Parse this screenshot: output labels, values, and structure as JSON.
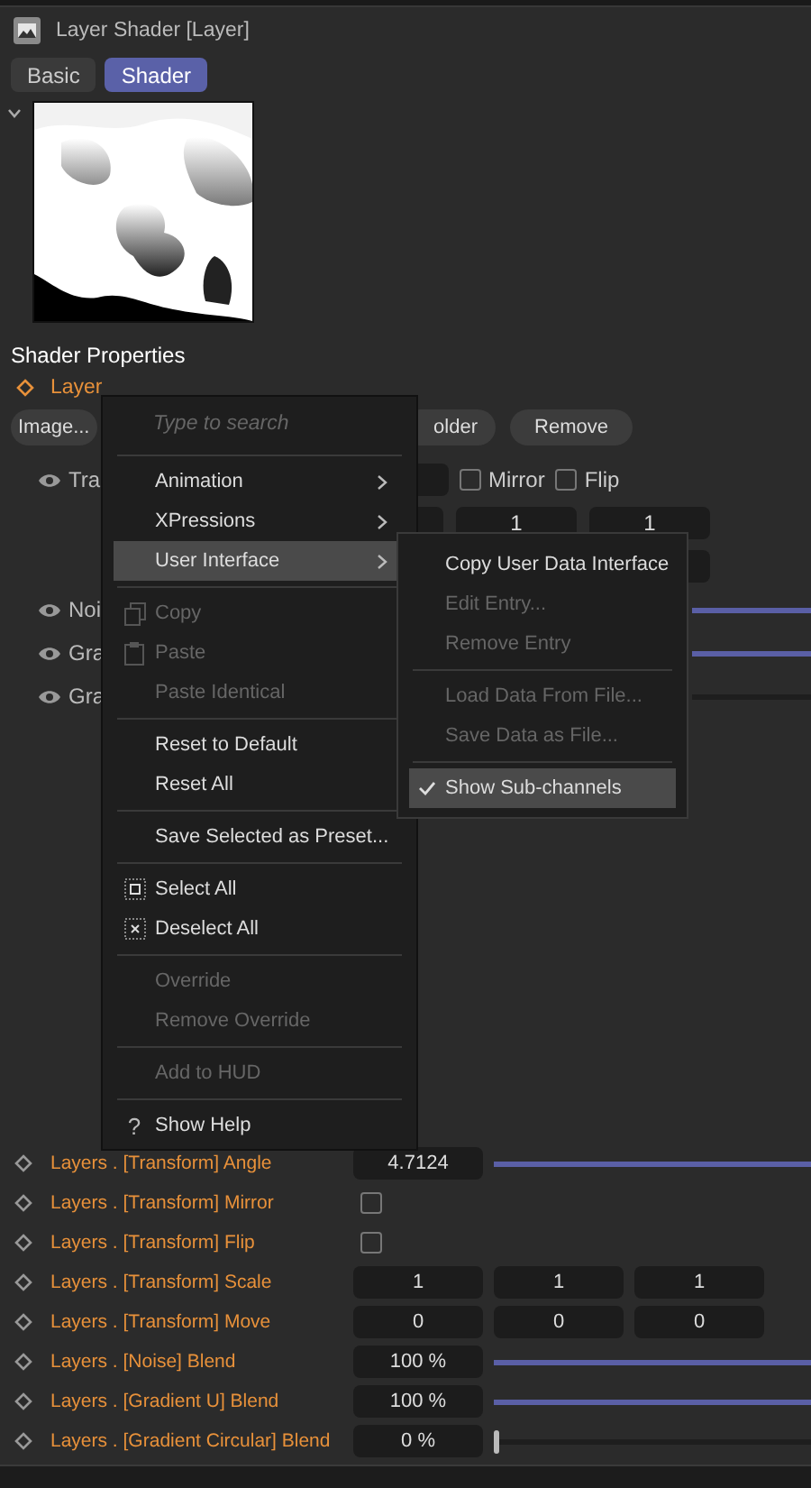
{
  "window": {
    "title": "Layer Shader [Layer]"
  },
  "tabs": [
    {
      "label": "Basic",
      "selected": false
    },
    {
      "label": "Shader",
      "selected": true
    }
  ],
  "preview": {
    "expanded": true
  },
  "section_title": "Shader Properties",
  "layers_label": "Layer",
  "buttons": [
    "Image...",
    "older",
    "Remove"
  ],
  "layer_rows": [
    {
      "kind": "transform",
      "label": "Tra",
      "visible": true
    },
    {
      "kind": "slider",
      "label": "Noi",
      "visible": true,
      "level": 1
    },
    {
      "kind": "slider",
      "label": "Gra",
      "visible": true,
      "level": 1
    },
    {
      "kind": "slider",
      "label": "Gra",
      "visible": true
    }
  ],
  "transform_options": [
    {
      "label": "Mirror",
      "checked": false
    },
    {
      "label": "Flip",
      "checked": false
    }
  ],
  "scale_fields": [
    "1",
    "1"
  ],
  "user_data_rows": [
    {
      "kind": "slider",
      "label": "Layers . [Transform] Angle",
      "value": "4.7124",
      "level": 1
    },
    {
      "kind": "checkbox",
      "label": "Layers . [Transform] Mirror",
      "checked": false
    },
    {
      "kind": "checkbox",
      "label": "Layers . [Transform] Flip",
      "checked": false
    },
    {
      "kind": "vector",
      "label": "Layers . [Transform] Scale",
      "values": [
        "1",
        "1",
        "1"
      ]
    },
    {
      "kind": "vector",
      "label": "Layers . [Transform] Move",
      "values": [
        "0",
        "0",
        "0"
      ]
    },
    {
      "kind": "slider",
      "label": "Layers . [Noise] Blend",
      "value": "100 %",
      "level": 1
    },
    {
      "kind": "slider",
      "label": "Layers . [Gradient U] Blend",
      "value": "100 %",
      "level": 1
    },
    {
      "kind": "slider",
      "label": "Layers . [Gradient Circular] Blend",
      "value": "0 %",
      "level": 0
    }
  ],
  "context_menu": {
    "search": {
      "placeholder": "Type to search"
    },
    "items": [
      {
        "kind": "separator"
      },
      {
        "kind": "submenu",
        "label": "Animation",
        "selected": false
      },
      {
        "kind": "submenu",
        "label": "XPressions",
        "selected": false
      },
      {
        "kind": "submenu",
        "label": "User Interface",
        "selected": true
      },
      {
        "kind": "separator"
      },
      {
        "kind": "copy",
        "label": "Copy",
        "disabled": true
      },
      {
        "kind": "paste",
        "label": "Paste",
        "disabled": true
      },
      {
        "kind": "plain",
        "label": "Paste Identical",
        "disabled": true
      },
      {
        "kind": "separator"
      },
      {
        "kind": "plain",
        "label": "Reset to Default",
        "disabled": false
      },
      {
        "kind": "plain",
        "label": "Reset All",
        "disabled": false
      },
      {
        "kind": "separator"
      },
      {
        "kind": "plain",
        "label": "Save Selected as Preset...",
        "disabled": false
      },
      {
        "kind": "separator"
      },
      {
        "kind": "select",
        "label": "Select All",
        "disabled": false
      },
      {
        "kind": "deselect",
        "label": "Deselect All",
        "disabled": false
      },
      {
        "kind": "separator"
      },
      {
        "kind": "plain",
        "label": "Override",
        "disabled": true
      },
      {
        "kind": "plain",
        "label": "Remove Override",
        "disabled": true
      },
      {
        "kind": "separator"
      },
      {
        "kind": "plain",
        "label": "Add to HUD",
        "disabled": true
      },
      {
        "kind": "separator"
      },
      {
        "kind": "help",
        "label": "Show Help",
        "glyph": "?",
        "disabled": false
      }
    ]
  },
  "submenu": {
    "items": [
      {
        "kind": "plain",
        "label": "Copy User Data Interface",
        "disabled": false
      },
      {
        "kind": "plain",
        "label": "Edit Entry...",
        "disabled": true
      },
      {
        "kind": "plain",
        "label": "Remove Entry",
        "disabled": true
      },
      {
        "kind": "separator"
      },
      {
        "kind": "plain",
        "label": "Load Data From File...",
        "disabled": true
      },
      {
        "kind": "plain",
        "label": "Save Data as File...",
        "disabled": true
      },
      {
        "kind": "separator"
      },
      {
        "kind": "check",
        "label": "Show Sub-channels",
        "checked": true,
        "selected": true
      }
    ]
  }
}
